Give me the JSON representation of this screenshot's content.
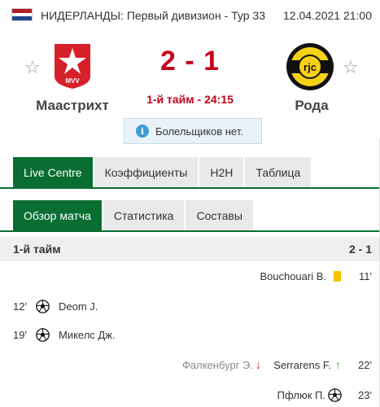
{
  "header": {
    "league": "НИДЕРЛАНДЫ: Первый дивизион - Тур 33",
    "datetime": "12.04.2021 21:00",
    "flag_colors": [
      "#ae1c28",
      "#ffffff",
      "#21468b"
    ]
  },
  "match": {
    "home_team": "Маастрихт",
    "away_team": "Рода",
    "score": "2 - 1",
    "status": "1-й тайм - 24:15",
    "home_logo_text": "MVV",
    "away_logo_text": "rjc",
    "notice": "Болельщиков нет.",
    "notice_icon": "i"
  },
  "main_tabs": [
    "Live Centre",
    "Коэффициенты",
    "H2H",
    "Таблица"
  ],
  "sub_tabs": [
    "Обзор матча",
    "Статистика",
    "Составы"
  ],
  "section": {
    "title": "1-й тайм",
    "score": "2 - 1"
  },
  "events": [
    {
      "side": "away",
      "minute": "11'",
      "type": "yellow-card",
      "player": "Bouchouari B."
    },
    {
      "side": "home",
      "minute": "12'",
      "type": "goal",
      "player": "Deom J."
    },
    {
      "side": "home",
      "minute": "19'",
      "type": "goal",
      "player": "Микелс Дж."
    },
    {
      "side": "away",
      "minute": "22'",
      "type": "substitution",
      "player_out": "Фалкенбург Э.",
      "player_in": "Serrarens F."
    },
    {
      "side": "away",
      "minute": "23'",
      "type": "goal",
      "player": "Пфлюк П."
    }
  ],
  "colors": {
    "accent": "#0a6e33",
    "score": "#c4001b",
    "yellow_card": "#f3c300"
  },
  "icons": {
    "star": "star-icon",
    "info": "info-icon",
    "goal": "ball-icon",
    "card": "yellow-card-icon",
    "sub_out": "arrow-down-icon",
    "sub_in": "arrow-up-icon"
  }
}
